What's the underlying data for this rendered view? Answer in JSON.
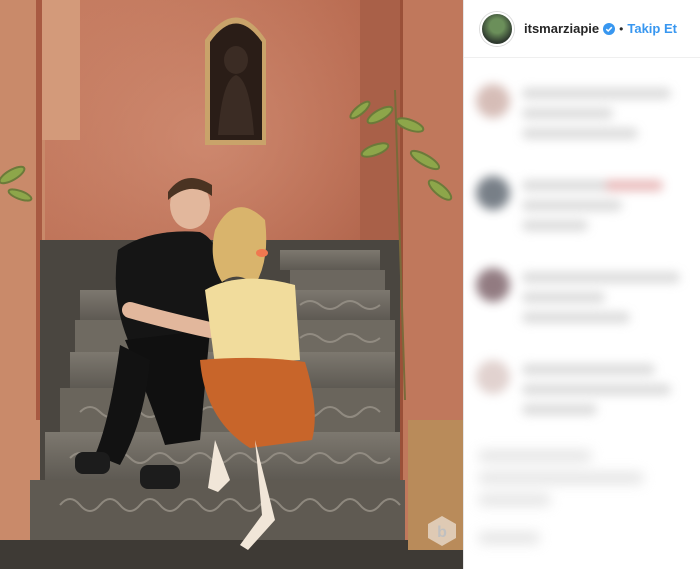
{
  "post": {
    "username": "itsmarziapie",
    "follow_label": "Takip Et",
    "separator": "•"
  },
  "icons": {
    "verified": "verified-badge-icon",
    "avatar": "profile-avatar",
    "watermark": "b-logo-watermark"
  },
  "colors": {
    "follow": "#3897f0",
    "verified": "#3897f0",
    "wall": "#b86a50",
    "skirt": "#c8652a"
  }
}
